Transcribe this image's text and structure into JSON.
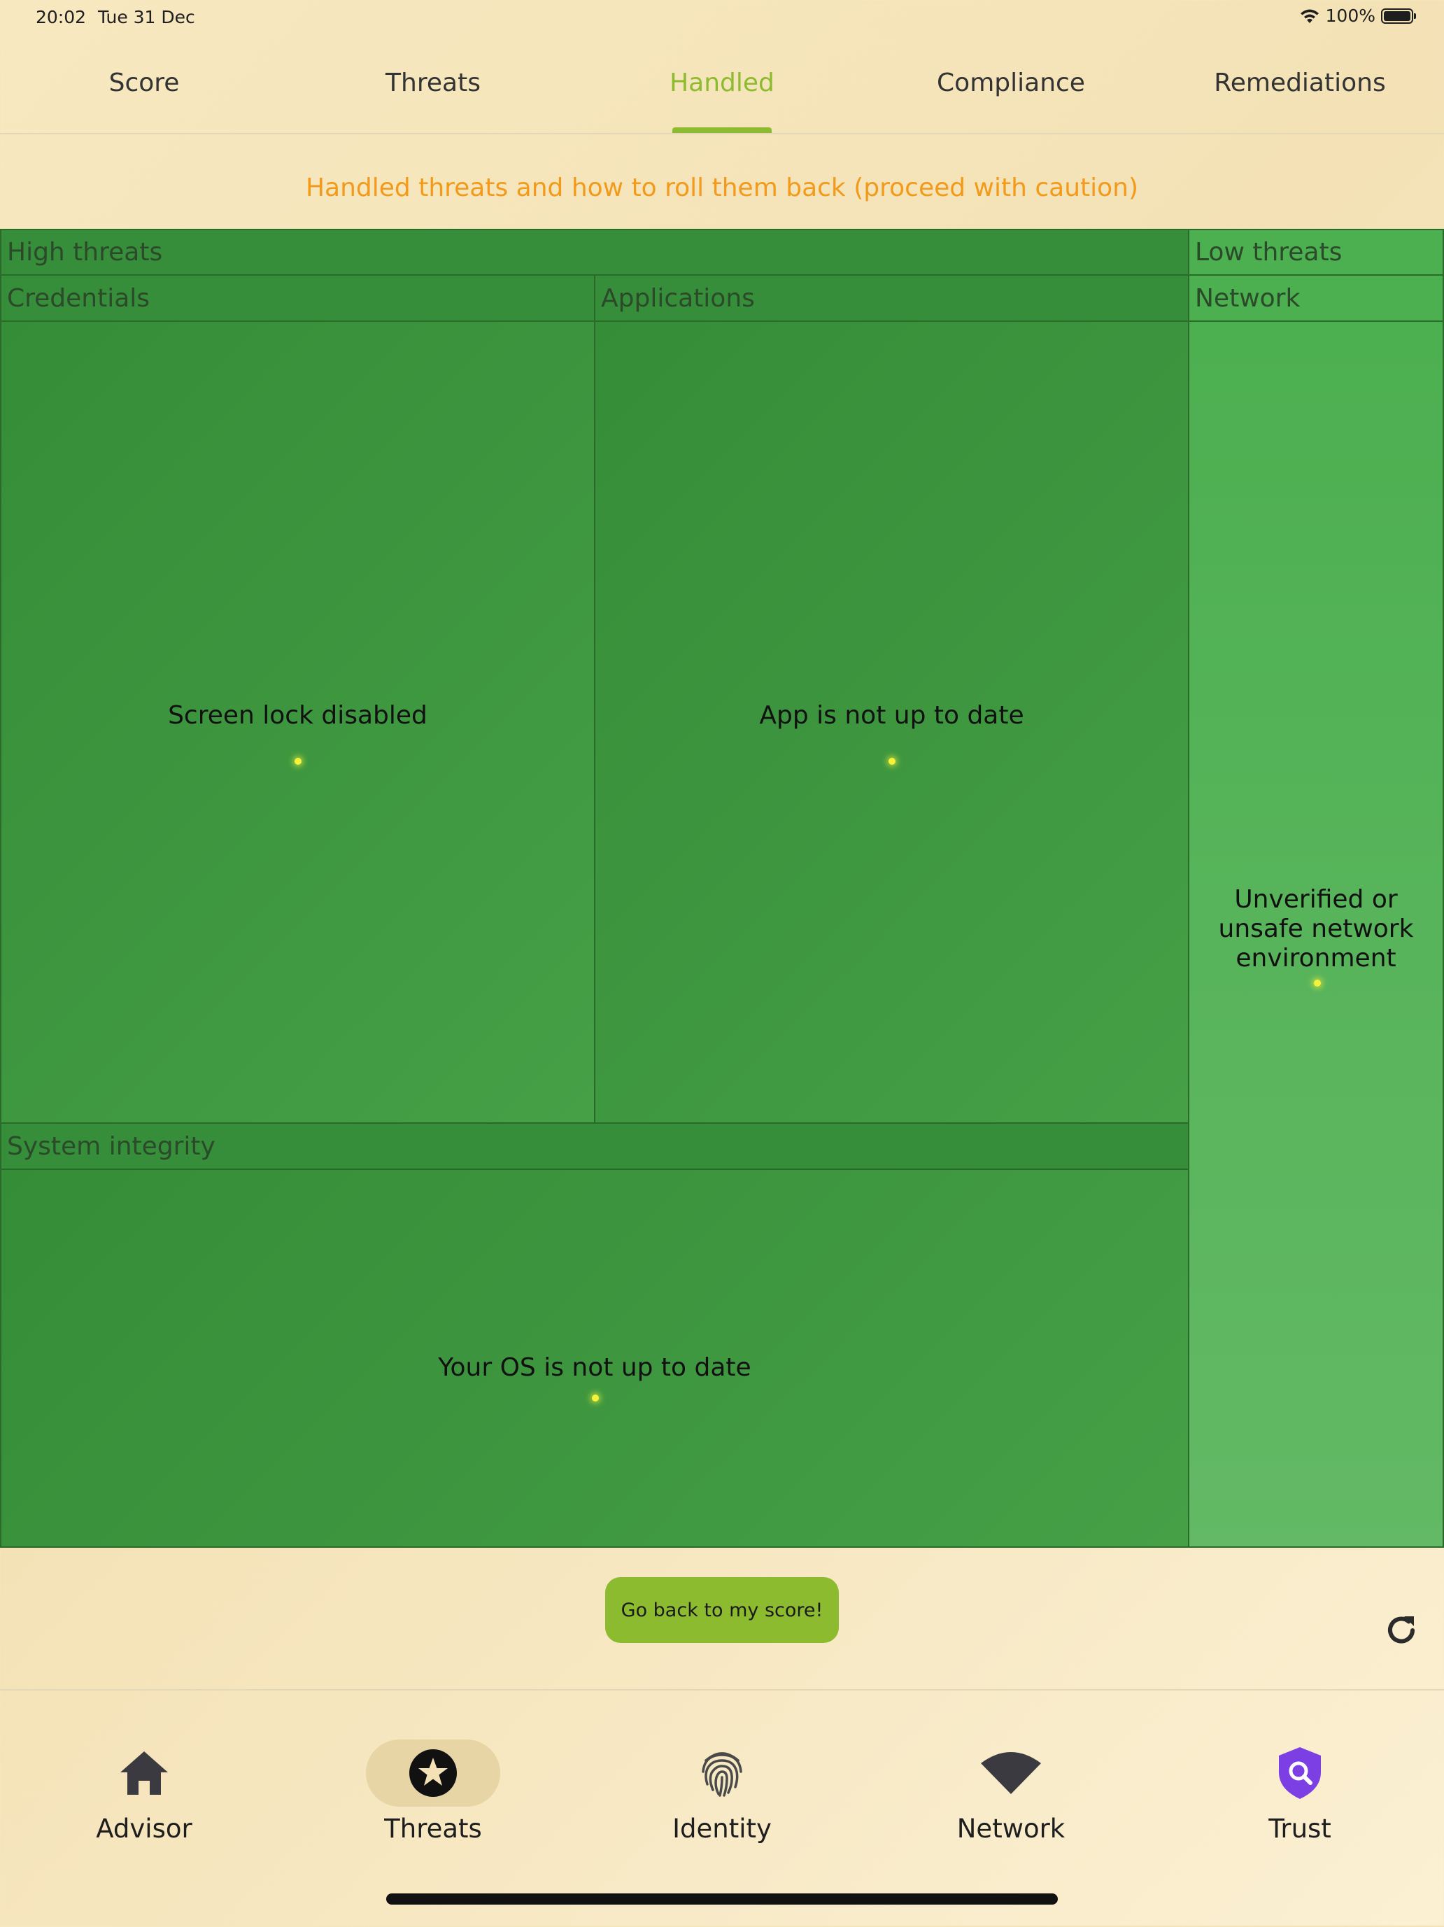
{
  "status_bar": {
    "time": "20:02",
    "date": "Tue 31 Dec",
    "battery_percent": "100%"
  },
  "tabs": [
    {
      "label": "Score",
      "active": false
    },
    {
      "label": "Threats",
      "active": false
    },
    {
      "label": "Handled",
      "active": true
    },
    {
      "label": "Compliance",
      "active": false
    },
    {
      "label": "Remediations",
      "active": false
    }
  ],
  "subtitle": "Handled threats and how to roll them back (proceed with caution)",
  "treemap": {
    "groups": [
      {
        "label": "High threats",
        "categories": [
          {
            "label": "Credentials",
            "items": [
              "Screen lock disabled"
            ]
          },
          {
            "label": "Applications",
            "items": [
              "App is not up to date"
            ]
          },
          {
            "label": "System integrity",
            "items": [
              "Your OS is not up to date"
            ]
          }
        ]
      },
      {
        "label": "Low threats",
        "categories": [
          {
            "label": "Network",
            "items": [
              "Unverified or unsafe network environment"
            ]
          }
        ]
      }
    ]
  },
  "back_button_label": "Go back to my score!",
  "bottom_nav": [
    {
      "label": "Advisor",
      "icon": "home-icon",
      "active": false
    },
    {
      "label": "Threats",
      "icon": "star-icon",
      "active": true
    },
    {
      "label": "Identity",
      "icon": "fingerprint-icon",
      "active": false
    },
    {
      "label": "Network",
      "icon": "wifi-icon",
      "active": false
    },
    {
      "label": "Trust",
      "icon": "shield-search-icon",
      "active": false
    }
  ],
  "colors": {
    "accent": "#8dbb2f",
    "subtitle": "#f39a1a",
    "high_threat": "#388e3c",
    "low_threat": "#4caf50",
    "trust_icon": "#7b3fe4"
  }
}
